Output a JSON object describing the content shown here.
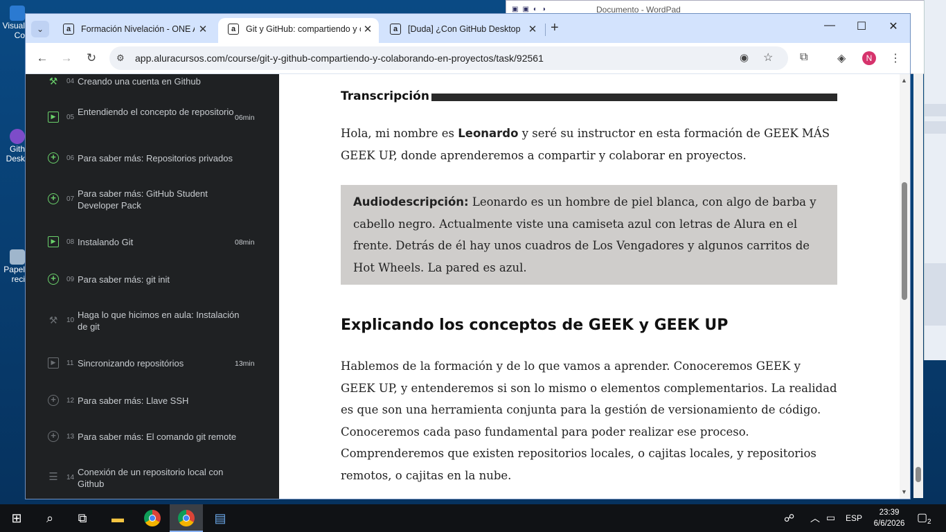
{
  "desktop": {
    "icons": [
      {
        "label_top": "Visual",
        "label_bottom": "Co"
      },
      {
        "label_top": "Gith",
        "label_bottom": "Desk"
      },
      {
        "label_top": "Papel",
        "label_bottom": "reci"
      }
    ],
    "wordpad_title": "Documento - WordPad"
  },
  "browser": {
    "tabs": [
      {
        "favicon": "a",
        "label": "Formación Nivelación - ONE Al",
        "active": false
      },
      {
        "favicon": "a",
        "label": "Git y GitHub: compartiendo y co",
        "active": true
      },
      {
        "favicon": "a",
        "label": "[Duda] ¿Con GitHub Desktop no",
        "active": false
      }
    ],
    "new_tab": "+",
    "url": "app.aluracursos.com/course/git-y-github-compartiendo-y-colaborando-en-proyectos/task/92561",
    "profile_initial": "N"
  },
  "sidebar": {
    "lessons": [
      {
        "num": "04",
        "title": "Creando una cuenta en Github",
        "duration": "",
        "icon": "tools-icon",
        "dim": false
      },
      {
        "num": "05",
        "title": "Entendiendo el concepto de repositorio",
        "duration": "06min",
        "icon": "video-icon",
        "dim": false
      },
      {
        "num": "06",
        "title": "Para saber más: Repositorios privados",
        "duration": "",
        "icon": "plus-circle-icon",
        "dim": false
      },
      {
        "num": "07",
        "title": "Para saber más: GitHub Student Developer Pack",
        "duration": "",
        "icon": "plus-circle-icon",
        "dim": false
      },
      {
        "num": "08",
        "title": "Instalando Git",
        "duration": "08min",
        "icon": "video-icon",
        "dim": false
      },
      {
        "num": "09",
        "title": "Para saber más: git init",
        "duration": "",
        "icon": "plus-circle-icon",
        "dim": false
      },
      {
        "num": "10",
        "title": "Haga lo que hicimos en aula: Instalación de git",
        "duration": "",
        "icon": "tools-icon",
        "dim": true
      },
      {
        "num": "11",
        "title": "Sincronizando repositórios",
        "duration": "13min",
        "icon": "video-icon",
        "dim": true
      },
      {
        "num": "12",
        "title": "Para saber más: Llave SSH",
        "duration": "",
        "icon": "plus-circle-icon",
        "dim": true
      },
      {
        "num": "13",
        "title": "Para saber más: El comando git remote",
        "duration": "",
        "icon": "plus-circle-icon",
        "dim": true
      },
      {
        "num": "14",
        "title": "Conexión de un repositorio local con Github",
        "duration": "",
        "icon": "list-icon",
        "dim": true
      }
    ]
  },
  "content": {
    "transcription_heading": "Transcripción",
    "intro_pre": "Hola, mi nombre es ",
    "intro_name": "Leonardo",
    "intro_post": " y seré su instructor en esta formación de GEEK MÁS GEEK UP, donde aprenderemos a compartir y colaborar en proyectos.",
    "audio_label": "Audiodescripción:",
    "audio_text": " Leonardo es un hombre de piel blanca, con algo de barba y cabello negro. Actualmente viste una camiseta azul con letras de Alura en el frente. Detrás de él hay unos cuadros de Los Vengadores y algunos carritos de Hot Wheels. La pared es azul.",
    "section_heading": "Explicando los conceptos de GEEK y GEEK UP",
    "section_text": "Hablemos de la formación y de lo que vamos a aprender. Conoceremos GEEK y GEEK UP, y entenderemos si son lo mismo o elementos complementarios. La realidad es que son una herramienta conjunta para la gestión de versionamiento de código. Conoceremos cada paso fundamental para poder realizar ese proceso. Comprenderemos que existen repositorios locales, o cajitas locales, y repositorios remotos, o cajitas en la nube."
  },
  "taskbar": {
    "language": "ESP",
    "time": "23:39",
    "date": "6/6/2026",
    "notifications": "2"
  }
}
